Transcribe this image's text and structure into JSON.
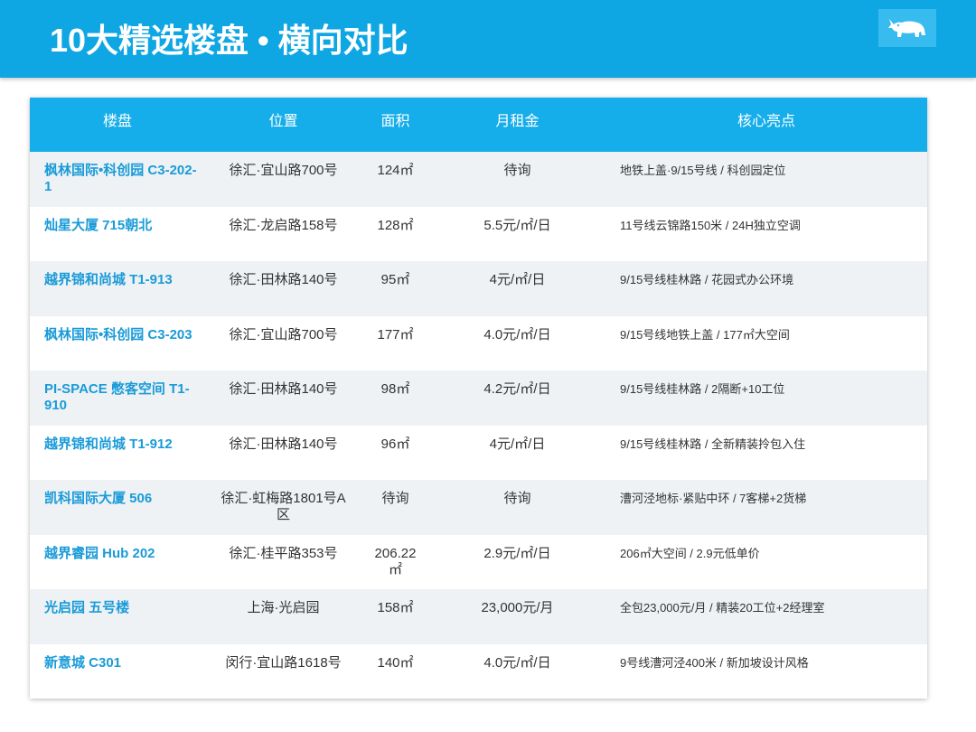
{
  "slide": {
    "title": "10大精选楼盘 • 横向对比",
    "logo_icon": "rhino-logo-icon"
  },
  "colors": {
    "header_blue": "#0ea6e3",
    "table_header_blue": "#15aeea",
    "property_name_blue": "#1a9bd8",
    "row_alt_bg": "#eef2f5",
    "body_text": "#333333"
  },
  "table": {
    "columns": [
      "楼盘",
      "位置",
      "面积",
      "月租金",
      "核心亮点"
    ],
    "rows": [
      {
        "name": "枫林国际•科创园 C3-202-1",
        "location": "徐汇·宜山路700号",
        "area": "124㎡",
        "rent": "待询",
        "highlights": "地铁上盖·9/15号线 / 科创园定位"
      },
      {
        "name": "灿星大厦 715朝北",
        "location": "徐汇·龙启路158号",
        "area": "128㎡",
        "rent": "5.5元/㎡/日",
        "highlights": "11号线云锦路150米 / 24H独立空调"
      },
      {
        "name": "越界锦和尚城 T1-913",
        "location": "徐汇·田林路140号",
        "area": "95㎡",
        "rent": "4元/㎡/日",
        "highlights": "9/15号线桂林路 / 花园式办公环境"
      },
      {
        "name": "枫林国际•科创园 C3-203",
        "location": "徐汇·宜山路700号",
        "area": "177㎡",
        "rent": "4.0元/㎡/日",
        "highlights": "9/15号线地铁上盖 / 177㎡大空间"
      },
      {
        "name": "PI-SPACE 憋客空间 T1-910",
        "location": "徐汇·田林路140号",
        "area": "98㎡",
        "rent": "4.2元/㎡/日",
        "highlights": "9/15号线桂林路 / 2隔断+10工位"
      },
      {
        "name": "越界锦和尚城 T1-912",
        "location": "徐汇·田林路140号",
        "area": "96㎡",
        "rent": "4元/㎡/日",
        "highlights": "9/15号线桂林路 / 全新精装拎包入住"
      },
      {
        "name": "凯科国际大厦 506",
        "location": "徐汇·虹梅路1801号A区",
        "area": "待询",
        "rent": "待询",
        "highlights": "漕河泾地标·紧贴中环 / 7客梯+2货梯"
      },
      {
        "name": "越界睿园 Hub 202",
        "location": "徐汇·桂平路353号",
        "area": "206.22㎡",
        "rent": "2.9元/㎡/日",
        "highlights": "206㎡大空间 / 2.9元低单价"
      },
      {
        "name": "光启园 五号楼",
        "location": "上海·光启园",
        "area": "158㎡",
        "rent": "23,000元/月",
        "highlights": "全包23,000元/月 / 精装20工位+2经理室"
      },
      {
        "name": "新意城 C301",
        "location": "闵行·宜山路1618号",
        "area": "140㎡",
        "rent": "4.0元/㎡/日",
        "highlights": "9号线漕河泾400米 / 新加坡设计风格"
      }
    ]
  }
}
